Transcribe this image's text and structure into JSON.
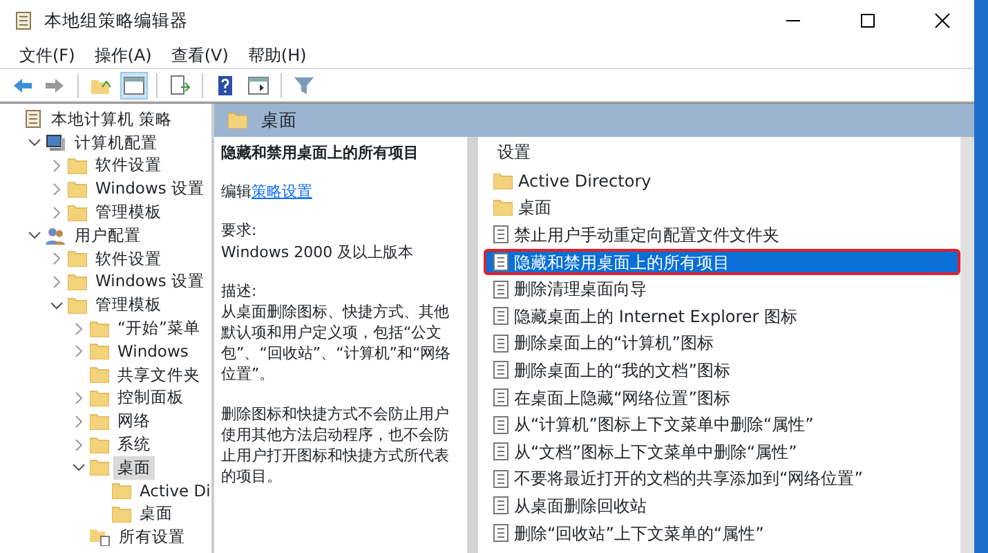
{
  "window": {
    "title": "本地组策略编辑器"
  },
  "menu": [
    "文件(F)",
    "操作(A)",
    "查看(V)",
    "帮助(H)"
  ],
  "tree": [
    {
      "label": "本地计算机 策略",
      "kind": "root",
      "selected": false,
      "children": [
        {
          "label": "计算机配置",
          "kind": "computer",
          "expanded": true,
          "selected": false,
          "children": [
            {
              "label": "软件设置",
              "kind": "folder",
              "expanded": false,
              "selected": false
            },
            {
              "label": "Windows 设置",
              "kind": "folder",
              "expanded": false,
              "selected": false
            },
            {
              "label": "管理模板",
              "kind": "folder",
              "expanded": false,
              "selected": false
            }
          ]
        },
        {
          "label": "用户配置",
          "kind": "user",
          "expanded": true,
          "selected": false,
          "children": [
            {
              "label": "软件设置",
              "kind": "folder",
              "expanded": false,
              "selected": false
            },
            {
              "label": "Windows 设置",
              "kind": "folder",
              "expanded": false,
              "selected": false
            },
            {
              "label": "管理模板",
              "kind": "folder",
              "expanded": true,
              "selected": false,
              "children": [
                {
                  "label": "“开始”菜单",
                  "kind": "folder",
                  "expanded": false,
                  "selected": false
                },
                {
                  "label": "Windows",
                  "kind": "folder",
                  "expanded": false,
                  "selected": false
                },
                {
                  "label": "共享文件夹",
                  "kind": "folder",
                  "selected": false
                },
                {
                  "label": "控制面板",
                  "kind": "folder",
                  "expanded": false,
                  "selected": false
                },
                {
                  "label": "网络",
                  "kind": "folder",
                  "expanded": false,
                  "selected": false
                },
                {
                  "label": "系统",
                  "kind": "folder",
                  "expanded": false,
                  "selected": false
                },
                {
                  "label": "桌面",
                  "kind": "folder",
                  "expanded": true,
                  "selected": true,
                  "children": [
                    {
                      "label": "Active Di",
                      "kind": "folder",
                      "selected": false
                    },
                    {
                      "label": "桌面",
                      "kind": "folder",
                      "selected": false
                    }
                  ]
                },
                {
                  "label": "所有设置",
                  "kind": "all",
                  "selected": false
                }
              ]
            }
          ]
        }
      ]
    }
  ],
  "pane": {
    "title": "桌面",
    "description": {
      "heading": "隐藏和禁用桌面上的所有项目",
      "edit_prefix": "编辑",
      "edit_link": "策略设置",
      "requirement_label": "要求:",
      "requirement": "Windows 2000 及以上版本",
      "description_label": "描述:",
      "paragraphs": [
        "从桌面删除图标、快捷方式、其他默认项和用户定义项，包括“公文包”、“回收站”、“计算机”和“网络位置”。",
        "删除图标和快捷方式不会防止用户使用其他方法启动程序，也不会防止用户打开图标和快捷方式所代表的项目。"
      ]
    },
    "list": {
      "column": "设置",
      "items": [
        {
          "label": "Active Directory",
          "kind": "folder",
          "selected": false,
          "highlighted": false
        },
        {
          "label": "桌面",
          "kind": "folder",
          "selected": false,
          "highlighted": false
        },
        {
          "label": "禁止用户手动重定向配置文件文件夹",
          "kind": "policy",
          "selected": false,
          "highlighted": false
        },
        {
          "label": "隐藏和禁用桌面上的所有项目",
          "kind": "policy",
          "selected": true,
          "highlighted": true
        },
        {
          "label": "删除清理桌面向导",
          "kind": "policy",
          "selected": false,
          "highlighted": false
        },
        {
          "label": "隐藏桌面上的 Internet Explorer 图标",
          "kind": "policy",
          "selected": false,
          "highlighted": false
        },
        {
          "label": "删除桌面上的“计算机”图标",
          "kind": "policy",
          "selected": false,
          "highlighted": false
        },
        {
          "label": "删除桌面上的“我的文档”图标",
          "kind": "policy",
          "selected": false,
          "highlighted": false
        },
        {
          "label": "在桌面上隐藏“网络位置”图标",
          "kind": "policy",
          "selected": false,
          "highlighted": false
        },
        {
          "label": "从“计算机”图标上下文菜单中删除“属性”",
          "kind": "policy",
          "selected": false,
          "highlighted": false
        },
        {
          "label": "从“文档”图标上下文菜单中删除“属性”",
          "kind": "policy",
          "selected": false,
          "highlighted": false
        },
        {
          "label": "不要将最近打开的文档的共享添加到“网络位置”",
          "kind": "policy",
          "selected": false,
          "highlighted": false
        },
        {
          "label": "从桌面删除回收站",
          "kind": "policy",
          "selected": false,
          "highlighted": false
        },
        {
          "label": "删除“回收站”上下文菜单的“属性”",
          "kind": "policy",
          "selected": false,
          "highlighted": false
        }
      ]
    }
  }
}
